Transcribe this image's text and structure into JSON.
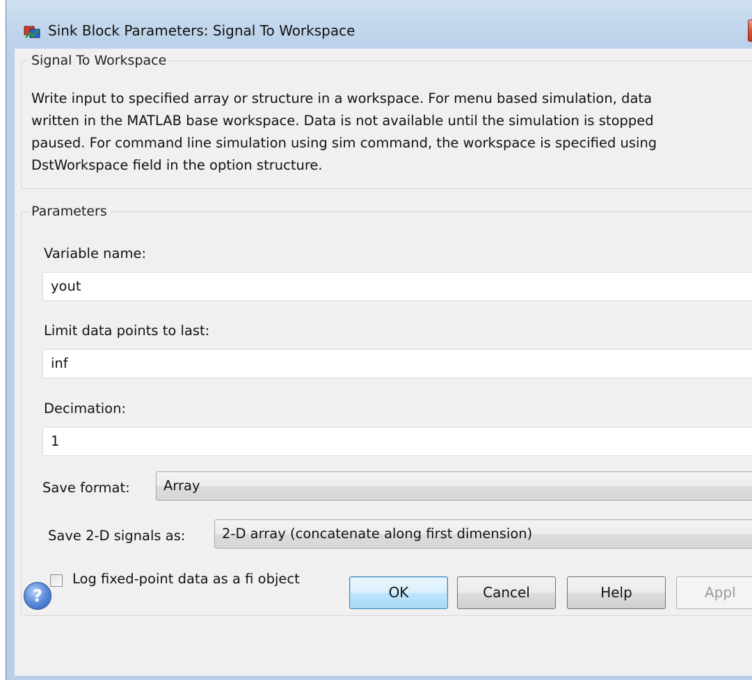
{
  "window": {
    "title": "Sink Block Parameters: Signal To Workspace"
  },
  "description_group": {
    "title": "Signal To Workspace",
    "lines": [
      "Write input to specified array or structure in a workspace. For menu based simulation, data",
      "written in the MATLAB base workspace. Data is not available until the simulation is stopped",
      "paused. For command line simulation using sim command, the workspace is specified using",
      "DstWorkspace field in the option structure."
    ]
  },
  "parameters": {
    "title": "Parameters",
    "variable_name": {
      "label": "Variable name:",
      "value": "yout"
    },
    "limit_points": {
      "label": "Limit data points to last:",
      "value": "inf"
    },
    "decimation": {
      "label": "Decimation:",
      "value": "1"
    },
    "save_format": {
      "label": "Save format:",
      "value": "Array"
    },
    "save_2d": {
      "label": "Save 2-D signals as:",
      "value": "2-D array (concatenate along first dimension)"
    },
    "log_fixed_point": {
      "label": "Log fixed-point data as a fi object",
      "checked": false
    }
  },
  "buttons": {
    "help_icon": "?",
    "ok": "OK",
    "cancel": "Cancel",
    "help": "Help",
    "apply": "Appl"
  },
  "icons": [
    "simulink-app-icon",
    "close-icon",
    "help-icon"
  ]
}
